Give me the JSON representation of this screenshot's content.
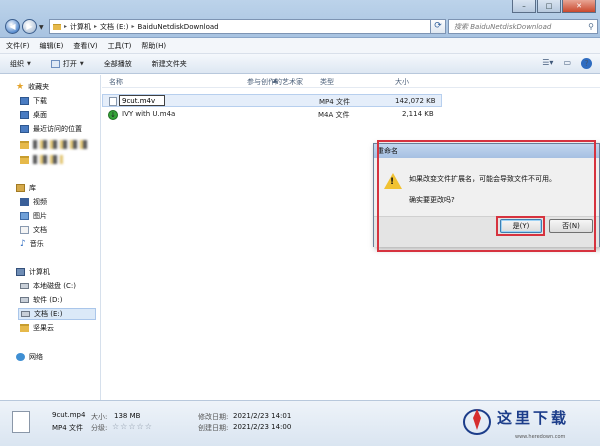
{
  "address": {
    "crumbs": [
      "计算机",
      "文档 (E:)",
      "BaiduNetdiskDownload"
    ],
    "search_placeholder": "搜索 BaiduNetdiskDownload"
  },
  "menu": [
    "文件(F)",
    "编辑(E)",
    "查看(V)",
    "工具(T)",
    "帮助(H)"
  ],
  "toolbar": {
    "organize": "组织",
    "open": "打开",
    "play_all": "全部播放",
    "new_folder": "新建文件夹"
  },
  "sidebar": {
    "favorites": "收藏夹",
    "fav_items": [
      "下载",
      "桌面",
      "最近访问的位置"
    ],
    "libraries": "库",
    "lib_items": [
      "视频",
      "图片",
      "文档",
      "音乐"
    ],
    "computer": "计算机",
    "drives": [
      "本地磁盘 (C:)",
      "软件 (D:)",
      "文档 (E:)",
      "坚果云"
    ],
    "network": "网络"
  },
  "columns": {
    "name": "名称",
    "artist": "参与创作的艺术家",
    "type": "类型",
    "size": "大小"
  },
  "files": [
    {
      "name": "9cut.m4v",
      "type": "MP4 文件",
      "size": "142,072 KB"
    },
    {
      "name": "IVY with U.m4a",
      "type": "M4A 文件",
      "size": "2,114 KB"
    }
  ],
  "dialog": {
    "title": "重命名",
    "message": "如果改变文件扩展名，可能会导致文件不可用。",
    "question": "确实要更改吗?",
    "yes": "是(Y)",
    "no": "否(N)"
  },
  "details": {
    "name": "9cut.mp4",
    "type": "MP4 文件",
    "size_label": "大小:",
    "size_value": "138 MB",
    "rating_label": "分级:",
    "modified_label": "修改日期:",
    "modified_value": "2021/2/23 14:01",
    "created_label": "创建日期:",
    "created_value": "2021/2/23 14:00"
  },
  "watermark": {
    "text": "这里下载",
    "url": "www.heredown.com"
  }
}
